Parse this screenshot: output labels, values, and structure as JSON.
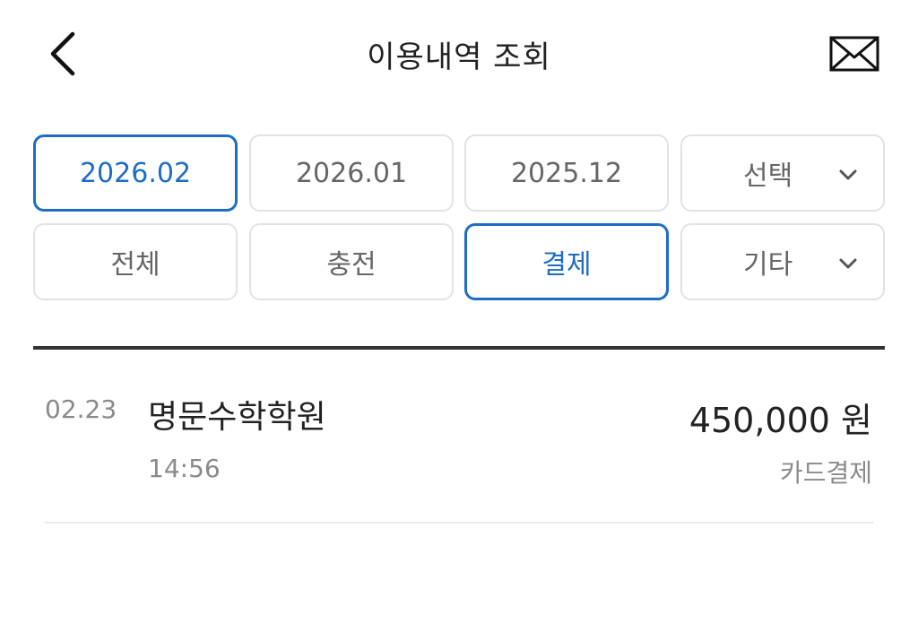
{
  "header": {
    "title": "이용내역 조회",
    "back_icon": "chevron-left-icon",
    "mail_icon": "envelope-icon"
  },
  "month_filters": [
    {
      "label": "2026.02",
      "selected": true
    },
    {
      "label": "2026.01",
      "selected": false
    },
    {
      "label": "2025.12",
      "selected": false
    },
    {
      "label": "선택",
      "selected": false,
      "dropdown": true
    }
  ],
  "type_filters": [
    {
      "label": "전체",
      "selected": false
    },
    {
      "label": "충전",
      "selected": false
    },
    {
      "label": "결제",
      "selected": true
    },
    {
      "label": "기타",
      "selected": false,
      "dropdown": true
    }
  ],
  "transactions": [
    {
      "date": "02.23",
      "merchant": "명문수학학원",
      "time": "14:56",
      "amount": "450,000 원",
      "method": "카드결제"
    }
  ],
  "colors": {
    "accent": "#1f6cc7",
    "text_primary": "#222222",
    "text_secondary": "#8a8a8a",
    "chip_border": "#e2e2e2"
  }
}
